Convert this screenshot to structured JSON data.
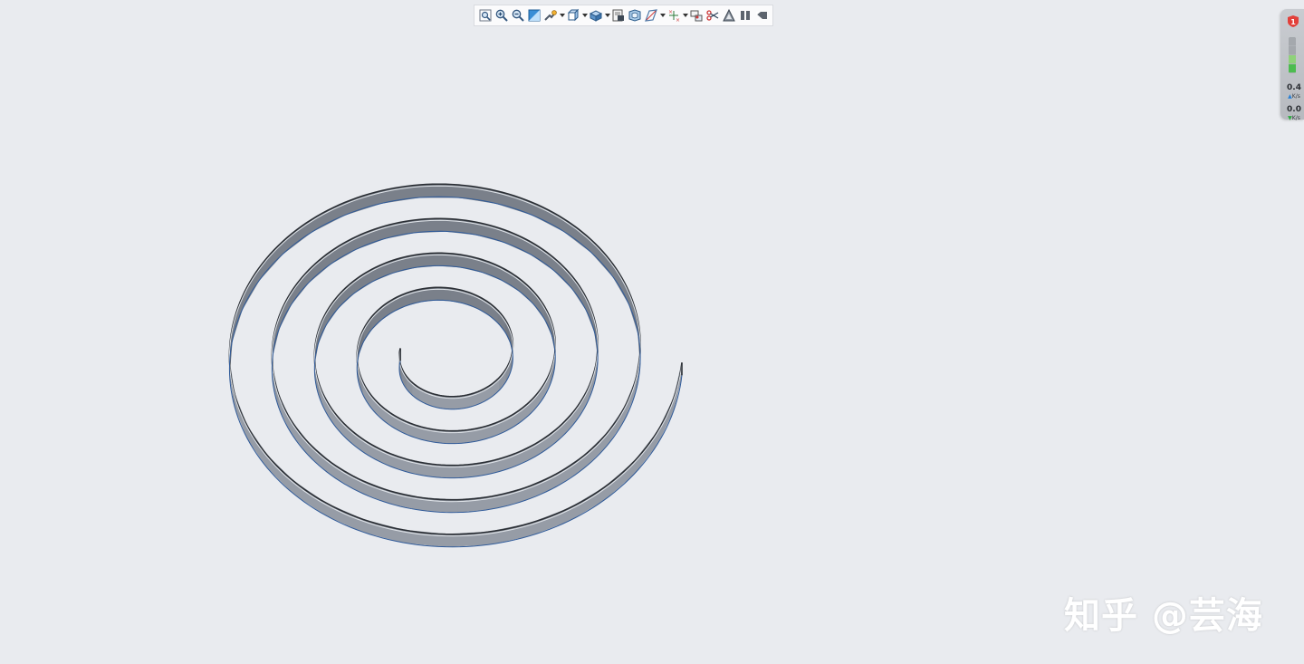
{
  "toolbar": {
    "items": [
      {
        "icon": "refit-icon",
        "dropdown": false
      },
      {
        "icon": "zoom-in-icon",
        "dropdown": false
      },
      {
        "icon": "zoom-out-icon",
        "dropdown": false
      },
      {
        "icon": "repaint-icon",
        "dropdown": false
      },
      {
        "icon": "reorient-icon",
        "dropdown": true
      },
      {
        "icon": "saved-orientations-icon",
        "dropdown": true
      },
      {
        "icon": "display-style-icon",
        "dropdown": true
      },
      {
        "icon": "view-manager-icon",
        "dropdown": false
      },
      {
        "icon": "perspective-icon",
        "dropdown": false
      },
      {
        "icon": "datum-display-icon",
        "dropdown": true
      },
      {
        "icon": "annotation-display-icon",
        "dropdown": true
      },
      {
        "icon": "spin-center-icon",
        "dropdown": false
      },
      {
        "icon": "section-icon",
        "dropdown": false
      },
      {
        "icon": "appearance-icon",
        "dropdown": false
      },
      {
        "icon": "pause-icon",
        "dropdown": false
      },
      {
        "icon": "regenerate-icon",
        "dropdown": false
      }
    ]
  },
  "perf_widget": {
    "badge": "1",
    "upload_value": "0.4",
    "upload_unit": "K/s",
    "download_value": "0.0",
    "download_unit": "K/s",
    "colors": {
      "badge": "#e2403a",
      "meter_light": "#8fd27a",
      "meter_dark": "#4cbc4f"
    }
  },
  "model": {
    "type": "flat-spiral-spring",
    "turns": 4.5,
    "color": "#7a818c"
  },
  "watermark": {
    "text": "知乎 @芸海"
  }
}
